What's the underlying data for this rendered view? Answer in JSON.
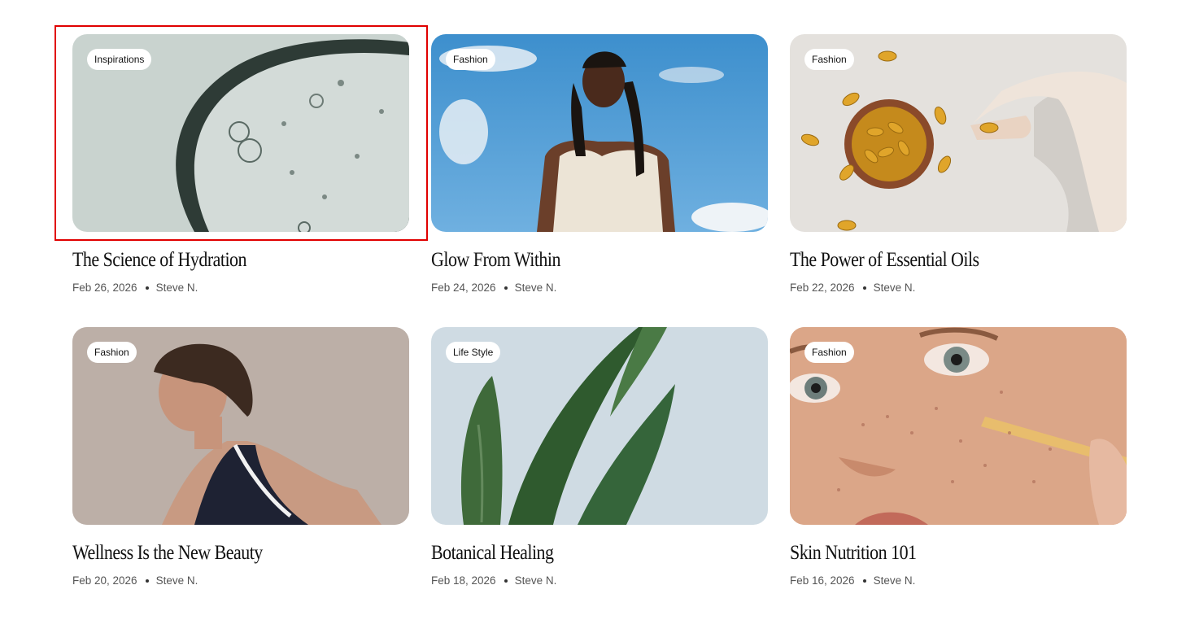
{
  "posts": [
    {
      "tag": "Inspirations",
      "title": "The Science of Hydration",
      "date": "Feb 26, 2026",
      "author": "Steve N."
    },
    {
      "tag": "Fashion",
      "title": "Glow From Within",
      "date": "Feb 24, 2026",
      "author": "Steve N."
    },
    {
      "tag": "Fashion",
      "title": "The Power of Essential Oils",
      "date": "Feb 22, 2026",
      "author": "Steve N."
    },
    {
      "tag": "Fashion",
      "title": "Wellness Is the New Beauty",
      "date": "Feb 20, 2026",
      "author": "Steve N."
    },
    {
      "tag": "Life Style",
      "title": "Botanical Healing",
      "date": "Feb 18, 2026",
      "author": "Steve N."
    },
    {
      "tag": "Fashion",
      "title": "Skin Nutrition 101",
      "date": "Feb 16, 2026",
      "author": "Steve N."
    }
  ],
  "colors": {
    "highlight": "#e00000",
    "tag_bg": "#ffffff"
  }
}
